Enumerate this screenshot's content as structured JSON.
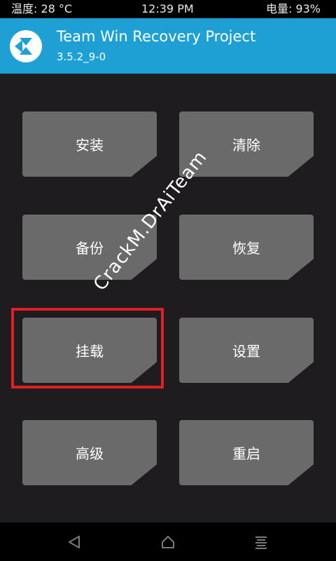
{
  "status_bar": {
    "temperature": "温度: 28 °C",
    "time": "12:39 PM",
    "battery": "电量: 93%"
  },
  "header": {
    "title": "Team Win Recovery Project",
    "version": "3.5.2_9-0",
    "logo_icon": "twrp-logo-icon"
  },
  "menu": {
    "install": "安装",
    "wipe": "清除",
    "backup": "备份",
    "restore": "恢复",
    "mount": "挂载",
    "settings": "设置",
    "advanced": "高级",
    "reboot": "重启"
  },
  "watermark": "CrackM.DrAiTeam",
  "nav": {
    "back_icon": "back-icon",
    "home_icon": "home-icon",
    "menu_icon": "menu-icon"
  },
  "colors": {
    "header": "#1fa0d4",
    "background": "#1f1c1f",
    "tile": "#6b6a6b",
    "highlight": "#e01e24"
  }
}
